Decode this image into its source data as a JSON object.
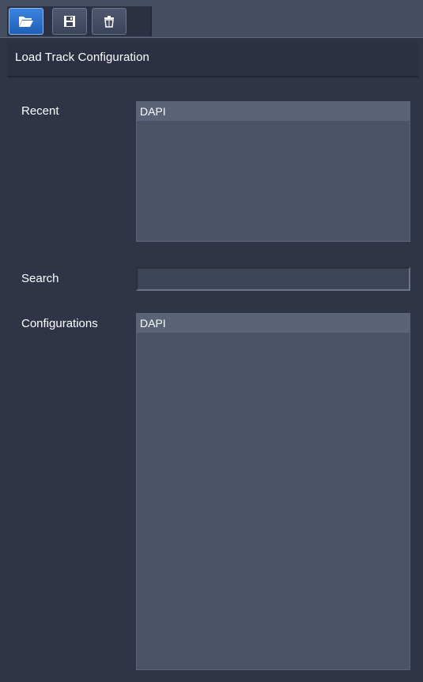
{
  "toolbar": {
    "buttons": [
      {
        "icon": "folder-open-icon",
        "active": true
      },
      {
        "icon": "save-icon",
        "active": false
      },
      {
        "icon": "trash-icon",
        "active": false
      }
    ]
  },
  "panel": {
    "title": "Load Track Configuration"
  },
  "recent": {
    "label": "Recent",
    "items": [
      "DAPI"
    ]
  },
  "search": {
    "label": "Search",
    "value": ""
  },
  "configurations": {
    "label": "Configurations",
    "items": [
      "DAPI"
    ]
  },
  "colors": {
    "background": "#2f3547",
    "toolbar": "#454d61",
    "list_background": "#4b5366",
    "selected_item": "#5a6377",
    "active_button": "#2f72d0"
  }
}
